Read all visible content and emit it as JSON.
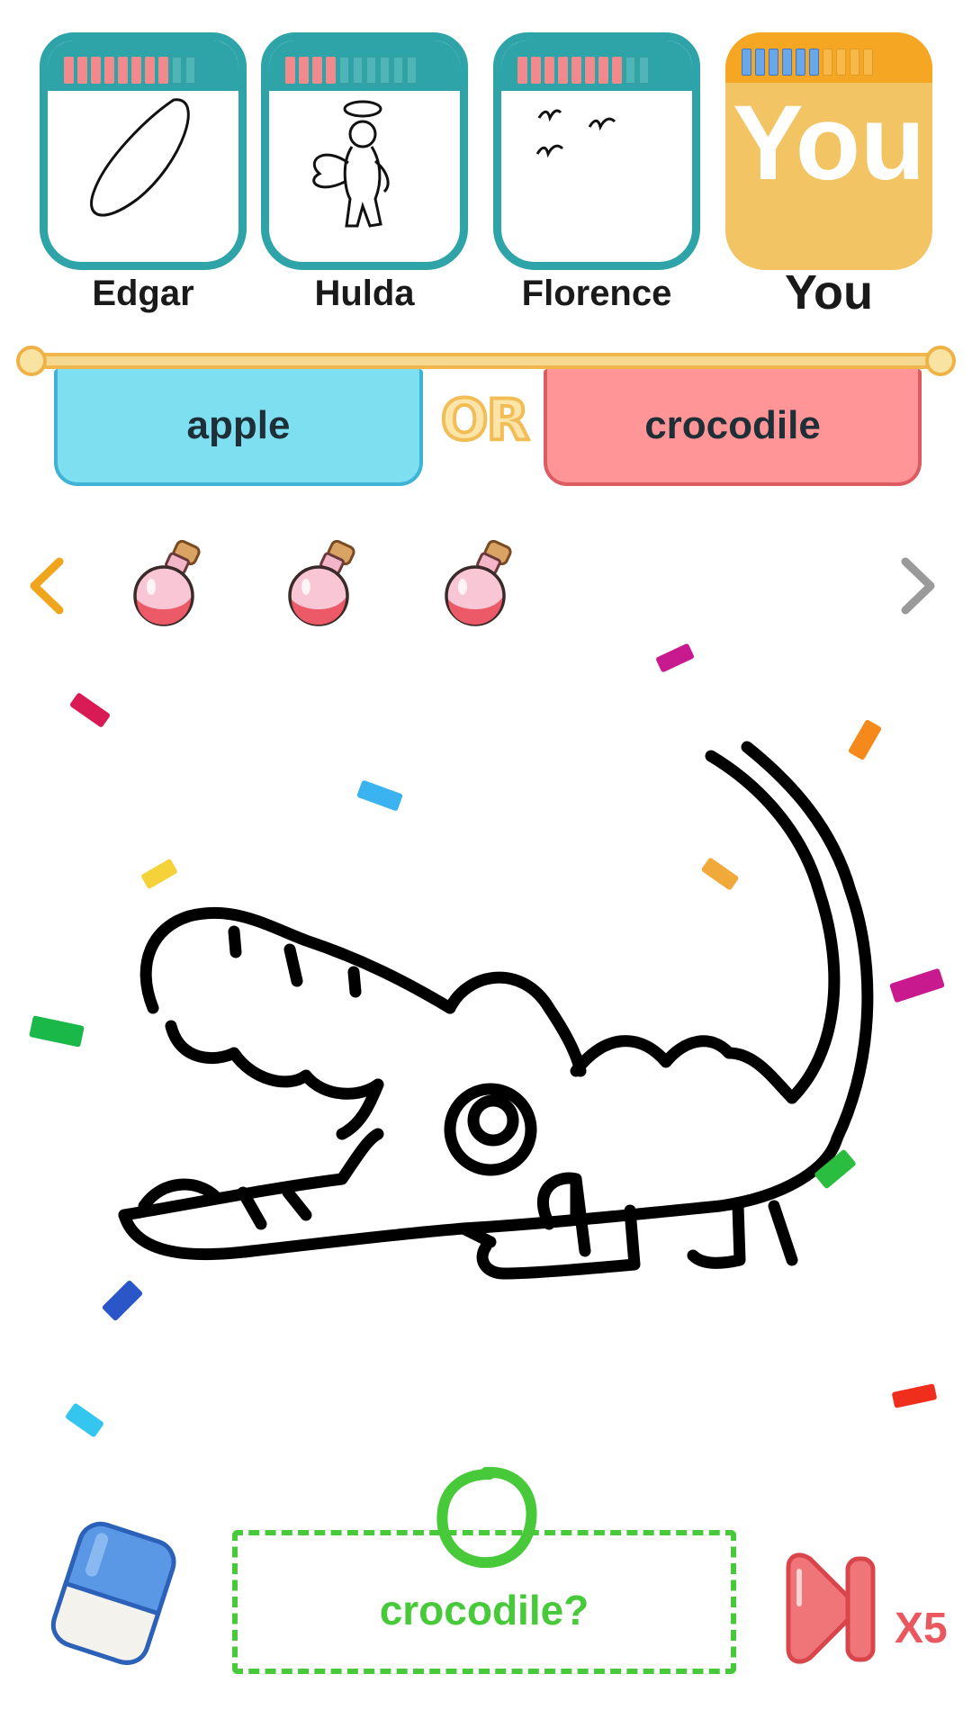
{
  "players": [
    {
      "name": "Edgar",
      "progress": {
        "filled": 8,
        "total": 10
      },
      "drawing": "oval-sketch"
    },
    {
      "name": "Hulda",
      "progress": {
        "filled": 4,
        "total": 10
      },
      "drawing": "angel-sketch"
    },
    {
      "name": "Florence",
      "progress": {
        "filled": 8,
        "total": 10
      },
      "drawing": "birds-sketch"
    },
    {
      "name": "You",
      "card_label": "You",
      "progress": {
        "filled": 6,
        "total": 10
      },
      "is_self": true
    }
  ],
  "choices": {
    "left": "apple",
    "separator": "OR",
    "right": "crocodile"
  },
  "powerups": {
    "items": [
      "potion-icon",
      "potion-icon",
      "potion-icon"
    ],
    "prev_arrow": "chevron-left-icon",
    "next_arrow": "chevron-right-icon"
  },
  "canvas": {
    "drawing": "crocodile-sketch"
  },
  "controls": {
    "eraser": "eraser-icon",
    "guess_text": "crocodile?",
    "skip": "skip-icon",
    "skip_count": "X5"
  },
  "colors": {
    "teal": "#2ea3a8",
    "you_card": "#f2c464",
    "left_choice": "#7ddff0",
    "right_choice": "#ff9597",
    "guess_green": "#47c93a",
    "skip_red": "#e9585e"
  }
}
